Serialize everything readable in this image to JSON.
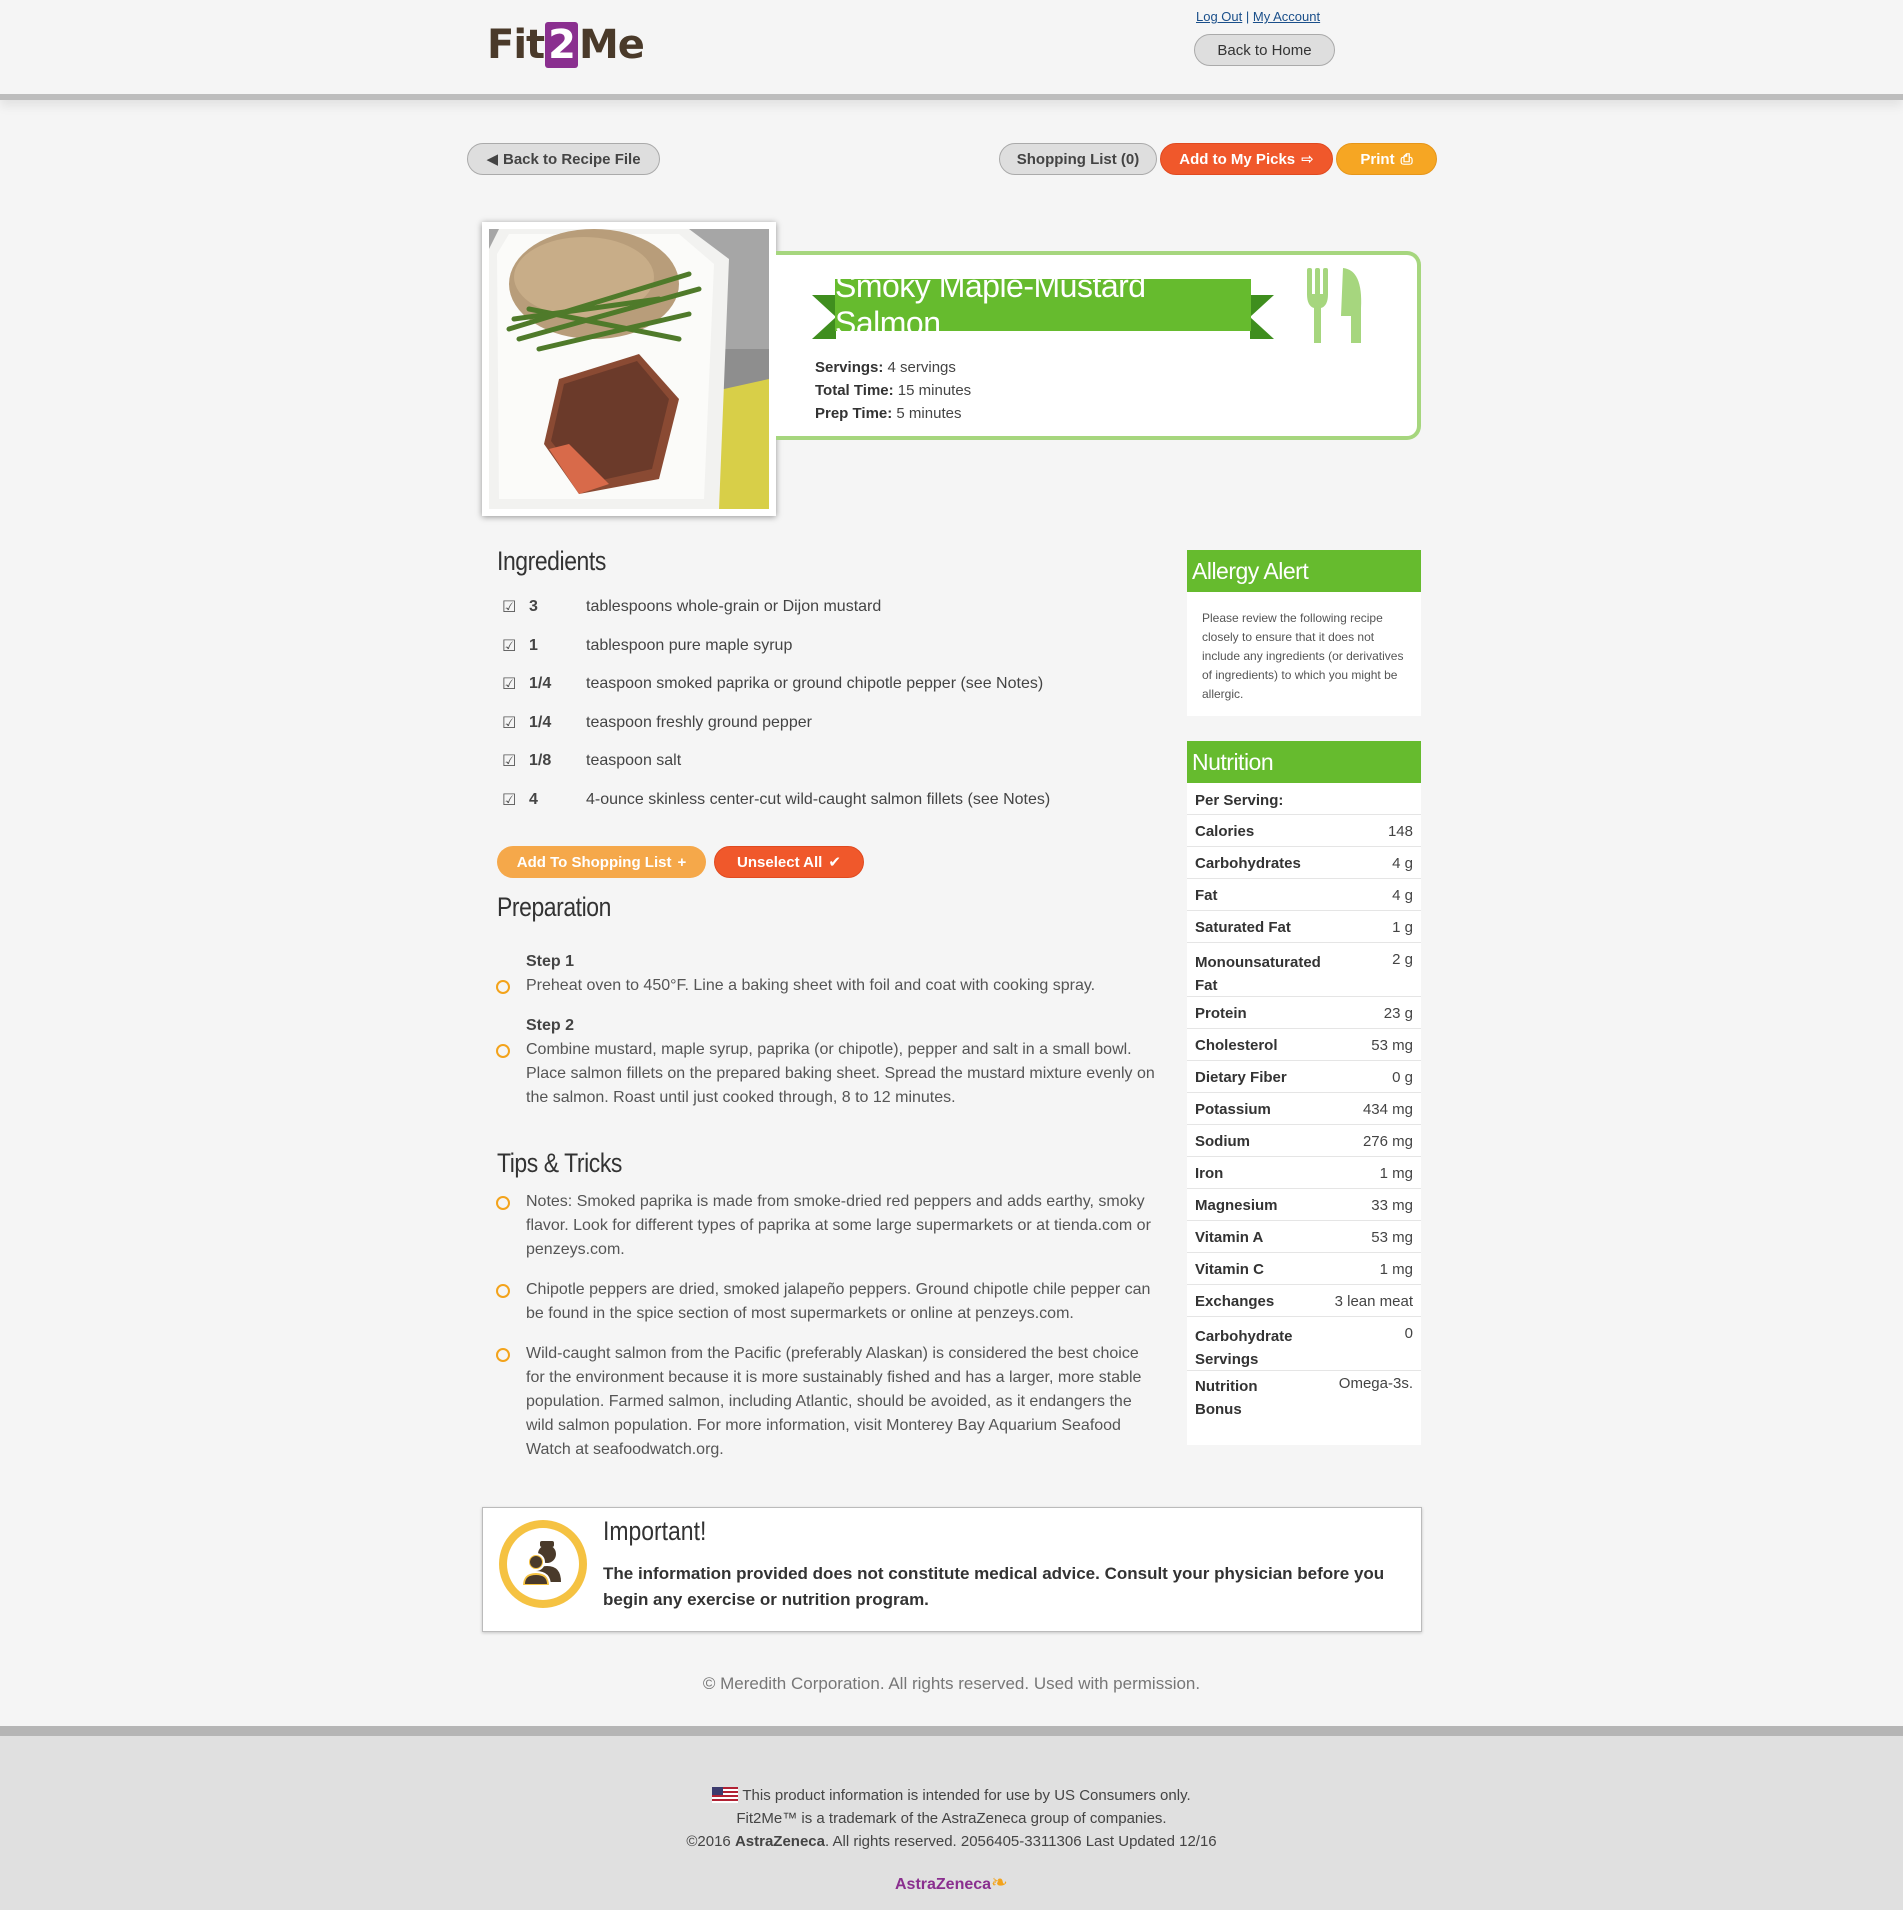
{
  "header": {
    "logo_pre": "Fit",
    "logo_two": "2",
    "logo_post": "Me",
    "logout": "Log Out",
    "separator": "|",
    "my_account": "My Account",
    "back_home": "Back to Home"
  },
  "toolbar": {
    "back_recipe": "Back to Recipe File",
    "shopping_list": "Shopping List (0)",
    "add_picks": "Add to My Picks",
    "print": "Print"
  },
  "recipe": {
    "title": "Smoky Maple-Mustard Salmon",
    "servings_label": "Servings:",
    "servings": "4 servings",
    "total_label": "Total Time:",
    "total": "15 minutes",
    "prep_label": "Prep Time:",
    "prep": "5 minutes"
  },
  "ingredients": {
    "heading": "Ingredients",
    "items": [
      {
        "qty": "3",
        "text": "tablespoons whole-grain or Dijon mustard"
      },
      {
        "qty": "1",
        "text": "tablespoon pure maple syrup"
      },
      {
        "qty": "1/4",
        "text": "teaspoon smoked paprika or ground chipotle pepper (see Notes)"
      },
      {
        "qty": "1/4",
        "text": "teaspoon freshly ground pepper"
      },
      {
        "qty": "1/8",
        "text": "teaspoon salt"
      },
      {
        "qty": "4",
        "text": "4-ounce skinless center-cut wild-caught salmon fillets (see Notes)"
      }
    ],
    "add_shopping": "Add To Shopping List",
    "unselect": "Unselect All"
  },
  "preparation": {
    "heading": "Preparation",
    "steps": [
      {
        "title": "Step 1",
        "lines": [
          "Preheat oven to 450°F. Line a baking sheet with foil and coat with cooking spray."
        ]
      },
      {
        "title": "Step 2",
        "lines": [
          "Combine mustard, maple syrup, paprika (or chipotle), pepper and salt in a small bowl.",
          "Place salmon fillets on the prepared baking sheet. Spread the mustard mixture evenly on",
          "the salmon. Roast until just cooked through, 8 to 12 minutes."
        ]
      }
    ]
  },
  "tips": {
    "heading": "Tips & Tricks",
    "items": [
      {
        "lines": [
          "Notes: Smoked paprika is made from smoke-dried red peppers and adds earthy, smoky",
          "flavor. Look for different types of paprika at some large supermarkets or at tienda.com or",
          "penzeys.com."
        ]
      },
      {
        "lines": [
          "Chipotle peppers are dried, smoked jalapeño peppers. Ground chipotle chile pepper can",
          "be found in the spice section of most supermarkets or online at penzeys.com."
        ]
      },
      {
        "lines": [
          "Wild-caught salmon from the Pacific (preferably Alaskan) is considered the best choice",
          "for the environment because it is more sustainably fished and has a larger, more stable",
          "population. Farmed salmon, including Atlantic, should be avoided, as it endangers the",
          "wild salmon population. For more information, visit Monterey Bay Aquarium Seafood",
          "Watch at seafoodwatch.org."
        ]
      }
    ]
  },
  "allergy": {
    "heading": "Allergy Alert",
    "text": "Please review the following recipe closely to ensure that it does not include any ingredients (or derivatives of ingredients) to which you might be allergic."
  },
  "nutrition": {
    "heading": "Nutrition",
    "per_serving": "Per Serving:",
    "rows": [
      {
        "label": "Calories",
        "value": "148"
      },
      {
        "label": "Carbohydrates",
        "value": "4 g"
      },
      {
        "label": "Fat",
        "value": "4 g"
      },
      {
        "label": "Saturated Fat",
        "value": "1 g"
      },
      {
        "label": "Monounsaturated Fat",
        "value": "2 g"
      },
      {
        "label": "Protein",
        "value": "23 g"
      },
      {
        "label": "Cholesterol",
        "value": "53 mg"
      },
      {
        "label": "Dietary Fiber",
        "value": "0 g"
      },
      {
        "label": "Potassium",
        "value": "434 mg"
      },
      {
        "label": "Sodium",
        "value": "276 mg"
      },
      {
        "label": "Iron",
        "value": "1 mg"
      },
      {
        "label": "Magnesium",
        "value": "33 mg"
      },
      {
        "label": "Vitamin A",
        "value": "53 mg"
      },
      {
        "label": "Vitamin C",
        "value": "1 mg"
      },
      {
        "label": "Exchanges",
        "value": "3 lean meat"
      },
      {
        "label": "Carbohydrate Servings",
        "value": "0"
      },
      {
        "label": "Nutrition Bonus",
        "value": "Omega-3s."
      }
    ]
  },
  "important": {
    "title": "Important!",
    "text": "The information provided does not constitute medical advice. Consult your physician before you begin any exercise or nutrition program."
  },
  "copyright": "© Meredith Corporation. All rights reserved. Used with permission.",
  "footer": {
    "line1": "This product information is intended for use by US Consumers only.",
    "line2": "Fit2Me™ is a trademark of the AstraZeneca group of companies.",
    "line3_pre": "©2016 ",
    "line3_bold": "AstraZeneca",
    "line3_post": ". All rights reserved. 2056405-3311306 Last Updated 12/16",
    "brand": "AstraZeneca"
  },
  "colors": {
    "green": "#66bb2e",
    "orange": "#f0582b",
    "yellow": "#f6a623",
    "purple": "#8a2f8f"
  }
}
